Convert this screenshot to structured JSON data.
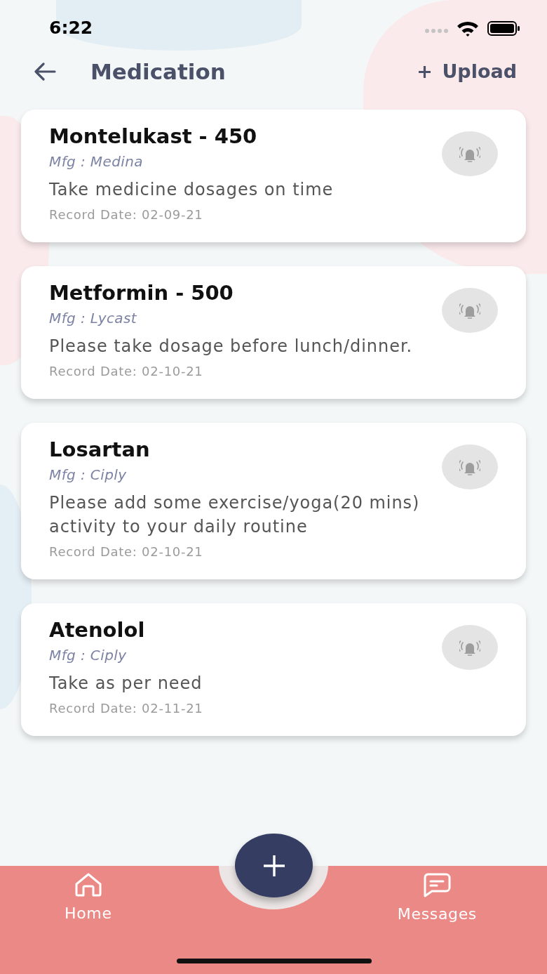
{
  "status_bar": {
    "time": "6:22"
  },
  "header": {
    "title": "Medication",
    "action": "Upload"
  },
  "medications": [
    {
      "name": "Montelukast - 450",
      "manufacturer": "Mfg : Medina",
      "note": "Take medicine dosages on time",
      "record_date": "Record Date: 02-09-21"
    },
    {
      "name": "Metformin - 500",
      "manufacturer": "Mfg : Lycast",
      "note": "Please take dosage before lunch/dinner.",
      "record_date": "Record Date: 02-10-21"
    },
    {
      "name": "Losartan",
      "manufacturer": "Mfg : Ciply",
      "note": "Please add some exercise/yoga(20 mins) activity to your daily routine",
      "record_date": "Record Date: 02-10-21"
    },
    {
      "name": "Atenolol",
      "manufacturer": "Mfg : Ciply",
      "note": "Take as per need",
      "record_date": "Record Date: 02-11-21"
    }
  ],
  "bottom_nav": {
    "items": [
      {
        "kind": "home",
        "label": "Home"
      },
      {
        "kind": "messages",
        "label": "Messages"
      }
    ]
  }
}
